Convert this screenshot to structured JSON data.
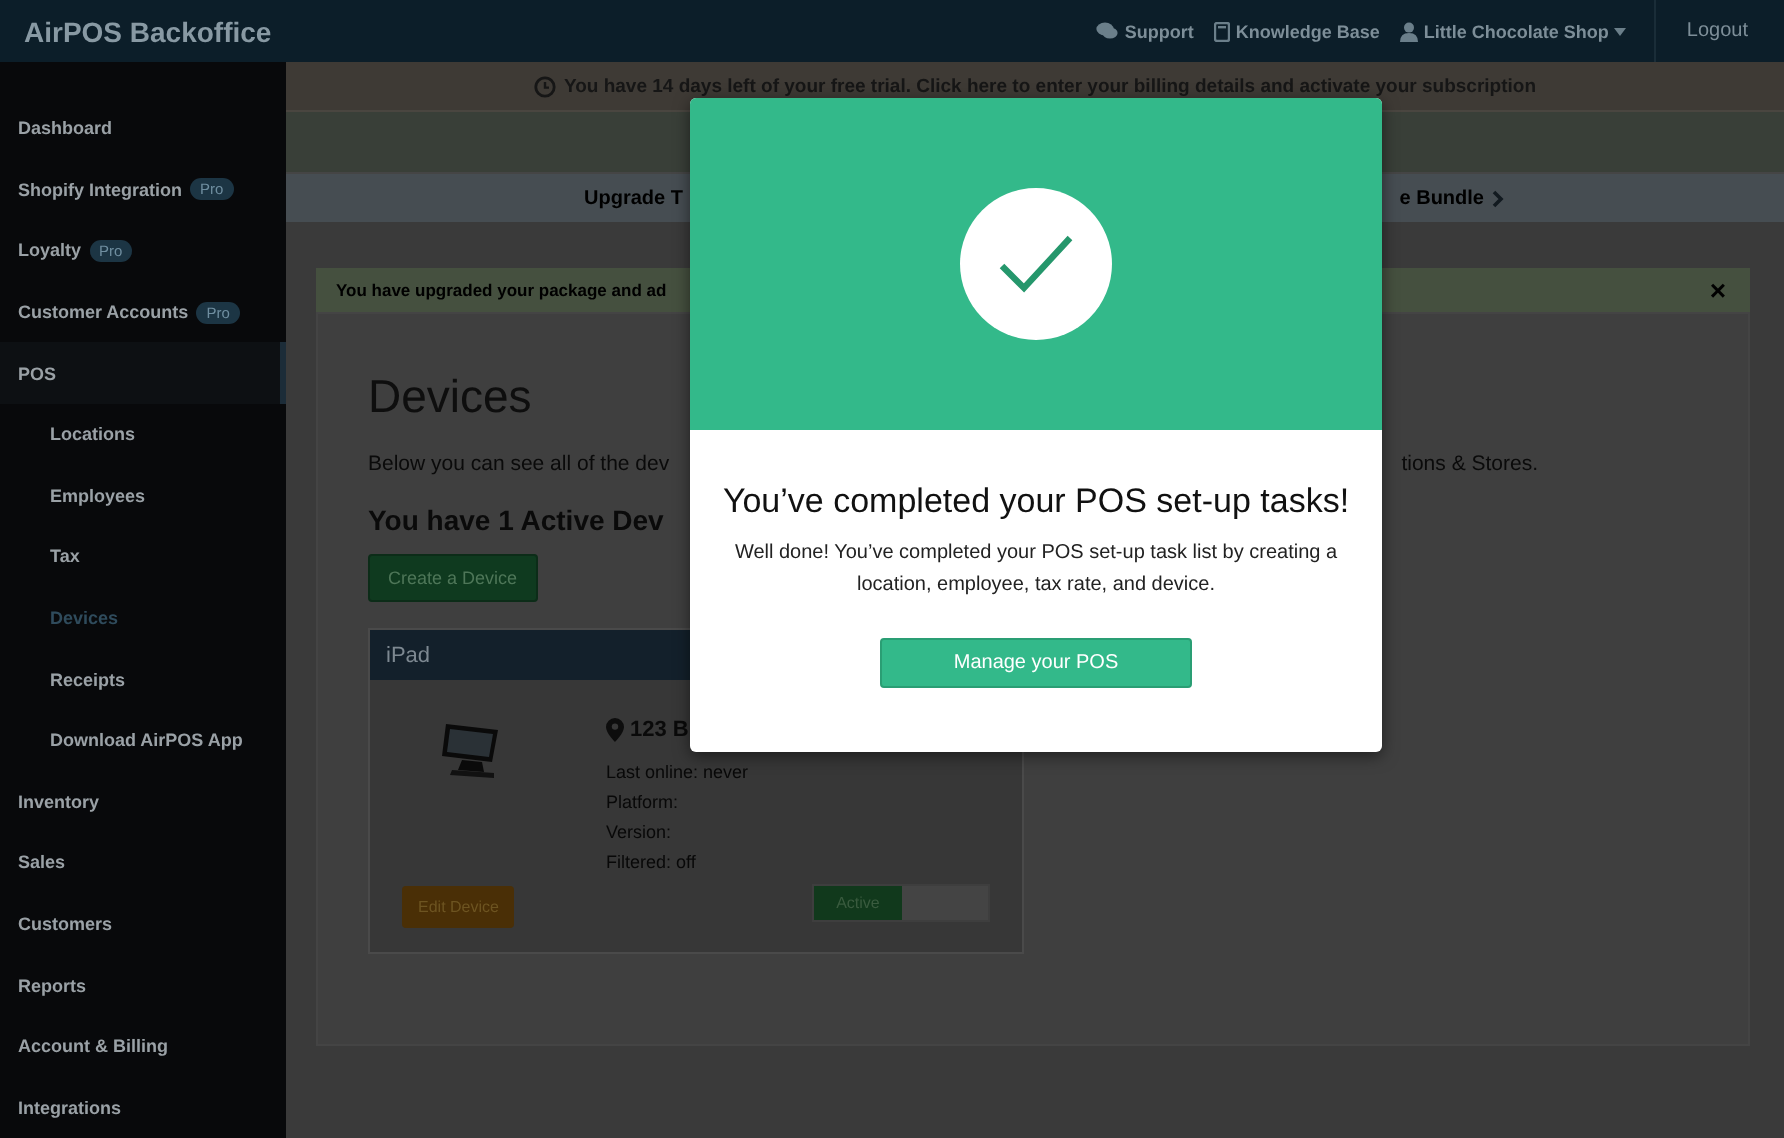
{
  "topbar": {
    "brand": "AirPOS Backoffice",
    "links": [
      {
        "kind": "support",
        "label": "Support"
      },
      {
        "kind": "book",
        "label": "Knowledge Base"
      },
      {
        "kind": "account",
        "label": "Little Chocolate Shop"
      }
    ],
    "logout": "Logout"
  },
  "sidebar": {
    "items": [
      {
        "label": "Dashboard",
        "selected": false
      },
      {
        "label": "Shopify Integration",
        "badge": "Pro",
        "selected": false
      },
      {
        "label": "Loyalty",
        "badge": "Pro",
        "selected": false
      },
      {
        "label": "Customer Accounts",
        "badge": "Pro",
        "selected": false
      },
      {
        "label": "POS",
        "selected": false,
        "expanded": true,
        "children": [
          {
            "label": "Locations",
            "selected": false
          },
          {
            "label": "Employees",
            "selected": false
          },
          {
            "label": "Tax",
            "selected": false
          },
          {
            "label": "Devices",
            "selected": true
          },
          {
            "label": "Receipts",
            "selected": false
          },
          {
            "label": "Download AirPOS App",
            "selected": false
          }
        ]
      },
      {
        "label": "Inventory",
        "selected": false
      },
      {
        "label": "Sales",
        "selected": false
      },
      {
        "label": "Customers",
        "selected": false
      },
      {
        "label": "Reports",
        "selected": false
      },
      {
        "label": "Account & Billing",
        "selected": false
      },
      {
        "label": "Integrations",
        "selected": false
      }
    ]
  },
  "trial_banner": "You have 14 days left of your free trial. Click here to enter your billing details and activate your subscription",
  "upgrade_banner": {
    "left": "Upgrade T",
    "right": "e Bundle"
  },
  "alert": {
    "text": "You have upgraded your package and ad",
    "close": "×"
  },
  "page": {
    "title": "Devices",
    "intro_left": "Below you can see all of the dev",
    "intro_right": "tions & Stores.",
    "subtitle": "You have 1 Active Dev",
    "create_button": "Create a Device",
    "device": {
      "name": "iPad",
      "address": "123 B",
      "details": [
        "Last online: never",
        "Platform:",
        "Version:",
        "Filtered: off"
      ],
      "edit_button": "Edit Device",
      "status": {
        "label": "Active",
        "on": true
      }
    }
  },
  "modal": {
    "title": "You’ve completed your POS set-up tasks!",
    "message": "Well done! You’ve completed your POS set-up task list by creating a location, employee, tax rate, and device.",
    "button": "Manage your POS"
  }
}
